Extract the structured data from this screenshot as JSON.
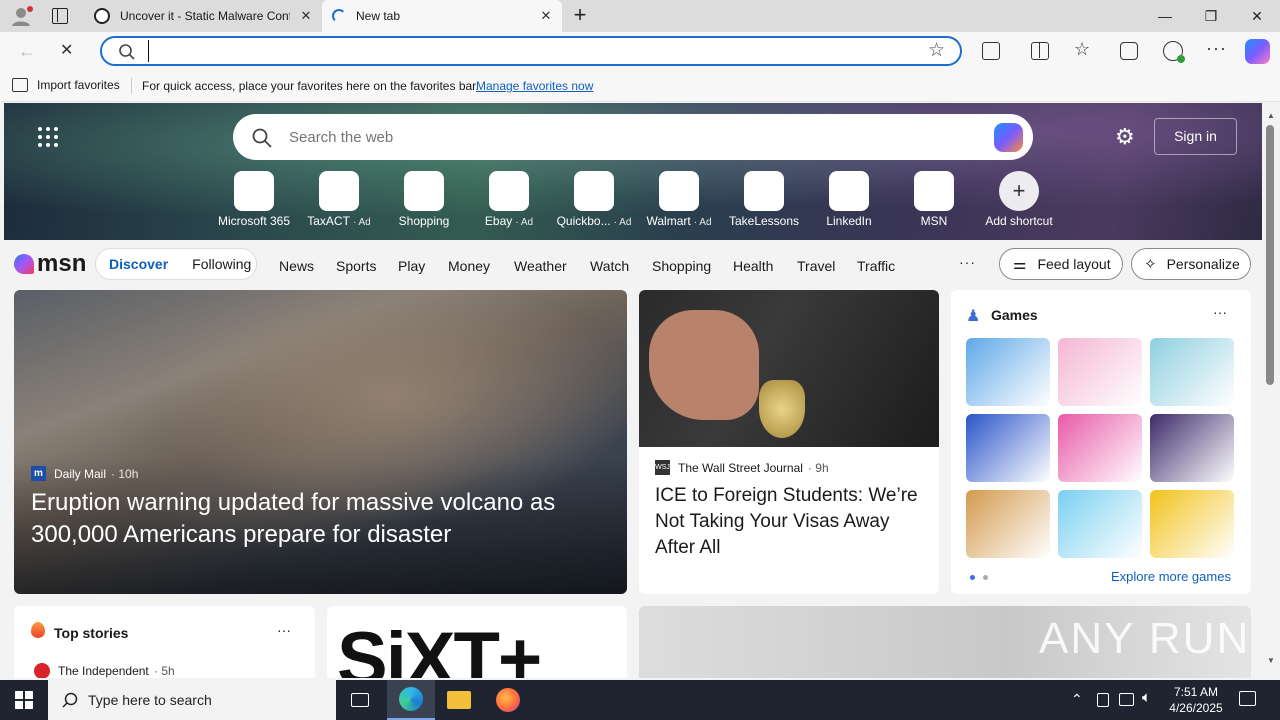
{
  "tabs": [
    {
      "title": "Uncover it - Static Malware Confi",
      "close": "✕"
    },
    {
      "title": "New tab",
      "close": "✕"
    }
  ],
  "new_tab_symbol": "+",
  "window_controls": {
    "minimize": "—",
    "restore": "❐",
    "close": "✕"
  },
  "address": {
    "value": "",
    "placeholder": ""
  },
  "favorites_bar": {
    "import_label": "Import favorites",
    "message": "For quick access, place your favorites here on the favorites bar.",
    "manage_link": "Manage favorites now"
  },
  "ntp": {
    "search_placeholder": "Search the web",
    "signin_label": "Sign in",
    "quick_links": [
      {
        "label": "Microsoft 365",
        "ad": ""
      },
      {
        "label": "TaxACT",
        "ad": "· Ad"
      },
      {
        "label": "Shopping",
        "ad": ""
      },
      {
        "label": "Ebay",
        "ad": "· Ad"
      },
      {
        "label": "Quickbo...",
        "ad": "· Ad"
      },
      {
        "label": "Walmart",
        "ad": "· Ad"
      },
      {
        "label": "TakeLessons",
        "ad": ""
      },
      {
        "label": "LinkedIn",
        "ad": ""
      },
      {
        "label": "MSN",
        "ad": ""
      },
      {
        "label": "Add shortcut",
        "ad": ""
      }
    ]
  },
  "msn": {
    "logo": "msn",
    "tabs": [
      "Discover",
      "Following"
    ],
    "nav": [
      "News",
      "Sports",
      "Play",
      "Money",
      "Weather",
      "Watch",
      "Shopping",
      "Health",
      "Travel",
      "Traffic"
    ],
    "more": "···",
    "feed_layout": "Feed layout",
    "personalize": "Personalize"
  },
  "hero_story": {
    "source": "Daily Mail",
    "age": "· 10h",
    "headline": "Eruption warning updated for massive volcano as 300,000 Americans prepare for disaster"
  },
  "side_story": {
    "source": "The Wall Street Journal",
    "age": "· 9h",
    "headline": "ICE to Foreign Students: We’re Not Taking Your Visas Away After All"
  },
  "games": {
    "title": "Games",
    "more": "···",
    "explore": "Explore more games",
    "tile_colors": [
      "#5fa8e8",
      "#f4b6d2",
      "#8fcfe0",
      "#2a55c9",
      "#e85aa8",
      "#3b2a6a",
      "#d49a4e",
      "#7ad0f0",
      "#f2c21a"
    ]
  },
  "top_stories": {
    "title": "Top stories",
    "more": "···",
    "first_source": "The Independent",
    "first_age": "· 5h"
  },
  "ad_text": "SiXT+",
  "watermark": "ANY RUN",
  "taskbar": {
    "search_placeholder": "Type here to search",
    "time": "7:51 AM",
    "date": "4/26/2025"
  },
  "colors": {
    "accent": "#1b6fd1",
    "link": "#0f5fbf"
  }
}
